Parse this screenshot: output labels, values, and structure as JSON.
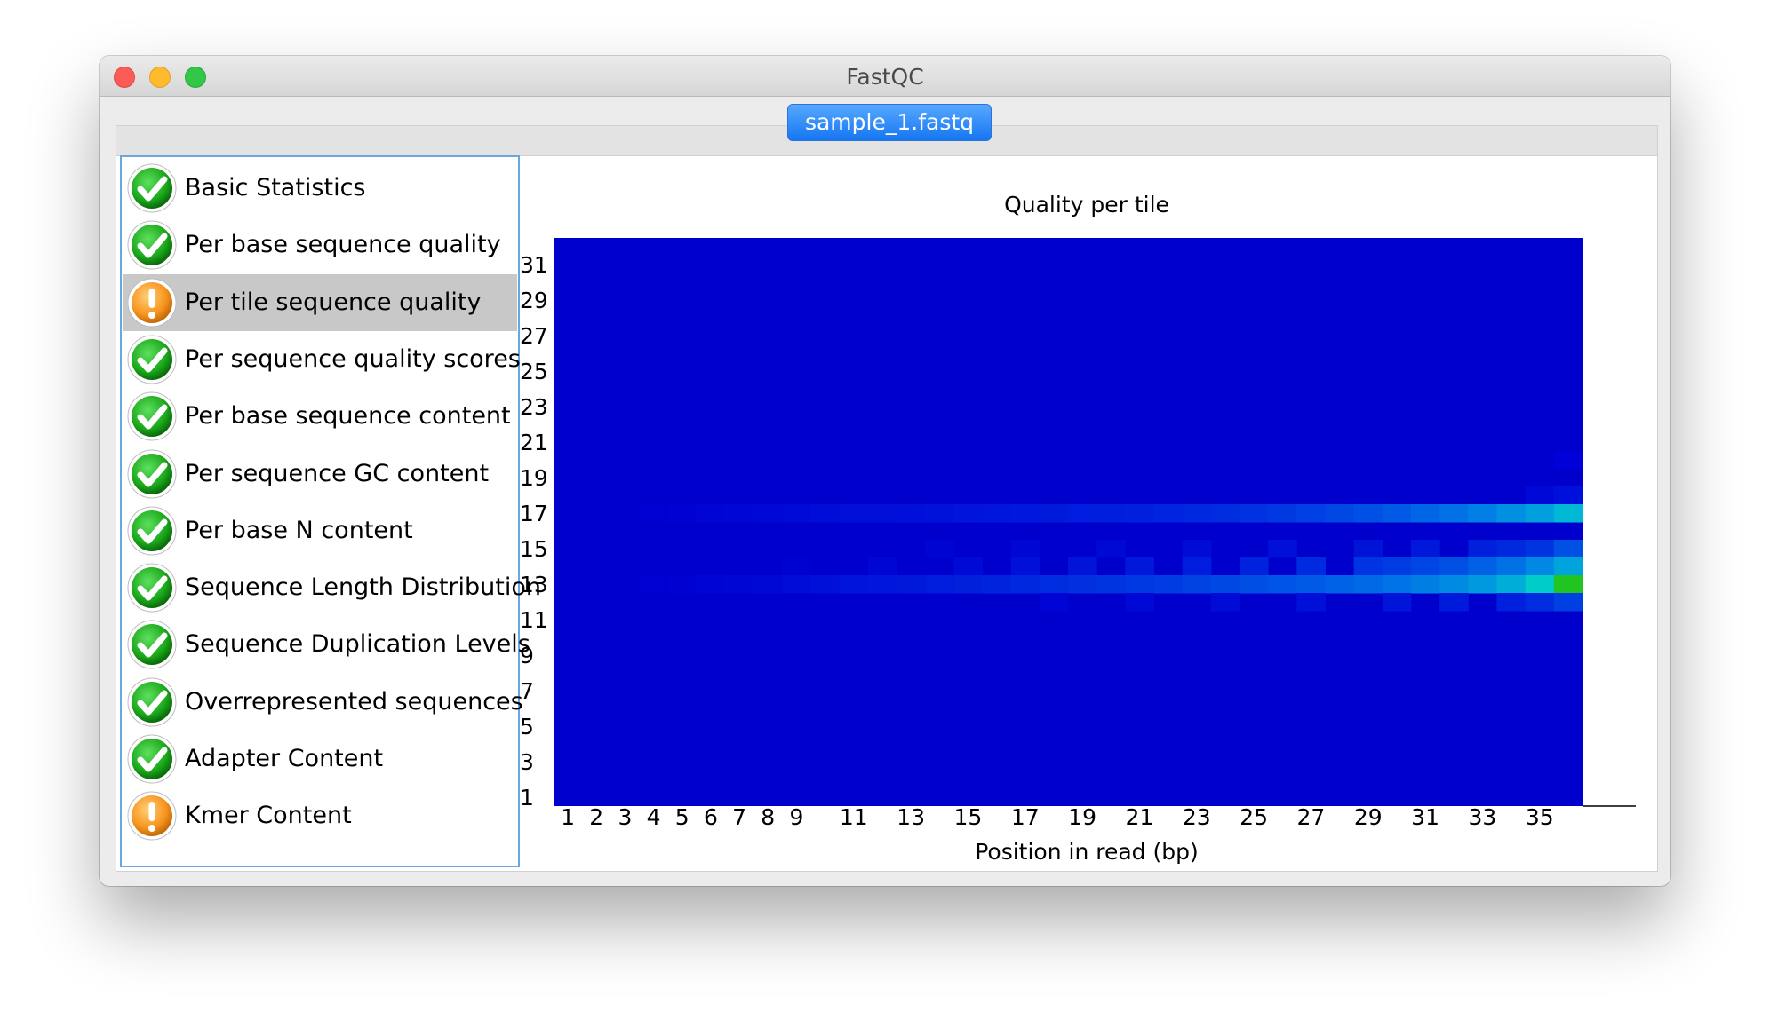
{
  "window": {
    "title": "FastQC"
  },
  "tab": {
    "label": "sample_1.fastq"
  },
  "modules": [
    {
      "label": "Basic Statistics",
      "status": "pass",
      "selected": false
    },
    {
      "label": "Per base sequence quality",
      "status": "pass",
      "selected": false
    },
    {
      "label": "Per tile sequence quality",
      "status": "warn",
      "selected": true
    },
    {
      "label": "Per sequence quality scores",
      "status": "pass",
      "selected": false
    },
    {
      "label": "Per base sequence content",
      "status": "pass",
      "selected": false
    },
    {
      "label": "Per sequence GC content",
      "status": "pass",
      "selected": false
    },
    {
      "label": "Per base N content",
      "status": "pass",
      "selected": false
    },
    {
      "label": "Sequence Length Distribution",
      "status": "pass",
      "selected": false
    },
    {
      "label": "Sequence Duplication Levels",
      "status": "pass",
      "selected": false
    },
    {
      "label": "Overrepresented sequences",
      "status": "pass",
      "selected": false
    },
    {
      "label": "Adapter Content",
      "status": "pass",
      "selected": false
    },
    {
      "label": "Kmer Content",
      "status": "warn",
      "selected": false
    }
  ],
  "icons": {
    "pass": "check-circle-icon",
    "warn": "warning-circle-icon"
  },
  "colors": {
    "pass": "#1aa81a",
    "warn": "#f7931e",
    "heat_base": "#0000cc",
    "selection": "#c8c8c8",
    "accent": "#1676f2"
  },
  "chart_data": {
    "type": "heatmap",
    "title": "Quality per tile",
    "xlabel": "Position in read (bp)",
    "ylabel": "",
    "x_ticks": [
      "1",
      "2",
      "3",
      "4",
      "5",
      "6",
      "7",
      "8",
      "9",
      "11",
      "13",
      "15",
      "17",
      "19",
      "21",
      "23",
      "25",
      "27",
      "29",
      "31",
      "33",
      "35"
    ],
    "y_ticks": [
      "31",
      "29",
      "27",
      "25",
      "23",
      "21",
      "19",
      "17",
      "15",
      "13",
      "11",
      "9",
      "7",
      "5",
      "3",
      "1"
    ],
    "x_range": [
      1,
      36
    ],
    "y_range": [
      1,
      32
    ],
    "background_color": "#0000cc",
    "hot_rows": [
      {
        "tile": 20,
        "cells": [
          [
            36,
            "#0000d8"
          ]
        ]
      },
      {
        "tile": 18,
        "cells": [
          [
            35,
            "#0008d8"
          ],
          [
            36,
            "#0010dc"
          ]
        ]
      },
      {
        "tile": 17,
        "cells": [
          [
            4,
            "#0000d2"
          ],
          [
            5,
            "#0002d4"
          ],
          [
            6,
            "#0004d4"
          ],
          [
            7,
            "#0006d6"
          ],
          [
            8,
            "#0008d6"
          ],
          [
            9,
            "#000ad8"
          ],
          [
            10,
            "#000cd8"
          ],
          [
            11,
            "#000ed8"
          ],
          [
            12,
            "#000ed8"
          ],
          [
            13,
            "#0010da"
          ],
          [
            14,
            "#0012da"
          ],
          [
            15,
            "#0014da"
          ],
          [
            16,
            "#0016dc"
          ],
          [
            17,
            "#0018dc"
          ],
          [
            18,
            "#001adc"
          ],
          [
            19,
            "#001cde"
          ],
          [
            20,
            "#001ede"
          ],
          [
            21,
            "#0020de"
          ],
          [
            22,
            "#0024e0"
          ],
          [
            23,
            "#0028e0"
          ],
          [
            24,
            "#002ce0"
          ],
          [
            25,
            "#0032e2"
          ],
          [
            26,
            "#0038e2"
          ],
          [
            27,
            "#0040e4"
          ],
          [
            28,
            "#0048e4"
          ],
          [
            29,
            "#0050e6"
          ],
          [
            30,
            "#005ae6"
          ],
          [
            31,
            "#0066e6"
          ],
          [
            32,
            "#0072e6"
          ],
          [
            33,
            "#0080e6"
          ],
          [
            34,
            "#0090e2"
          ],
          [
            35,
            "#00a0de"
          ],
          [
            36,
            "#00b8d4"
          ]
        ]
      },
      {
        "tile": 15,
        "cells": [
          [
            14,
            "#0004d2"
          ],
          [
            17,
            "#0006d4"
          ],
          [
            20,
            "#0008d4"
          ],
          [
            23,
            "#000cd6"
          ],
          [
            26,
            "#0010d8"
          ],
          [
            29,
            "#0014d8"
          ],
          [
            31,
            "#0018da"
          ],
          [
            33,
            "#0020dc"
          ],
          [
            34,
            "#0028de"
          ],
          [
            35,
            "#0034e0"
          ],
          [
            36,
            "#0050e4"
          ]
        ]
      },
      {
        "tile": 14,
        "cells": [
          [
            9,
            "#0002d0"
          ],
          [
            12,
            "#0006d4"
          ],
          [
            15,
            "#000ad6"
          ],
          [
            17,
            "#0010d8"
          ],
          [
            19,
            "#0014da"
          ],
          [
            21,
            "#0018da"
          ],
          [
            23,
            "#001cdc"
          ],
          [
            25,
            "#0022de"
          ],
          [
            27,
            "#002ae0"
          ],
          [
            29,
            "#0034e2"
          ],
          [
            30,
            "#003ce2"
          ],
          [
            31,
            "#0046e4"
          ],
          [
            32,
            "#0050e4"
          ],
          [
            33,
            "#0060e6"
          ],
          [
            34,
            "#0072e6"
          ],
          [
            35,
            "#0088e4"
          ],
          [
            36,
            "#00a4dc"
          ]
        ]
      },
      {
        "tile": 13,
        "cells": [
          [
            4,
            "#0000d2"
          ],
          [
            5,
            "#0002d2"
          ],
          [
            6,
            "#0004d4"
          ],
          [
            7,
            "#0006d4"
          ],
          [
            8,
            "#0008d6"
          ],
          [
            9,
            "#000cd8"
          ],
          [
            10,
            "#0010d8"
          ],
          [
            11,
            "#0014da"
          ],
          [
            12,
            "#0016da"
          ],
          [
            13,
            "#0018da"
          ],
          [
            14,
            "#001cdc"
          ],
          [
            15,
            "#0020dc"
          ],
          [
            16,
            "#0024de"
          ],
          [
            17,
            "#0028de"
          ],
          [
            18,
            "#002ce0"
          ],
          [
            19,
            "#0030e0"
          ],
          [
            20,
            "#0034e0"
          ],
          [
            21,
            "#0038e2"
          ],
          [
            22,
            "#003ce2"
          ],
          [
            23,
            "#0042e2"
          ],
          [
            24,
            "#0048e4"
          ],
          [
            25,
            "#004ee4"
          ],
          [
            26,
            "#0054e6"
          ],
          [
            27,
            "#005ae6"
          ],
          [
            28,
            "#0062e6"
          ],
          [
            29,
            "#006ae6"
          ],
          [
            30,
            "#0074e6"
          ],
          [
            31,
            "#007ee4"
          ],
          [
            32,
            "#008ae2"
          ],
          [
            33,
            "#0098de"
          ],
          [
            34,
            "#00acd8"
          ],
          [
            35,
            "#00ccc8"
          ],
          [
            36,
            "#22c422"
          ]
        ]
      },
      {
        "tile": 12,
        "cells": [
          [
            18,
            "#0004d4"
          ],
          [
            21,
            "#0008d6"
          ],
          [
            24,
            "#000cd6"
          ],
          [
            27,
            "#0010d8"
          ],
          [
            30,
            "#0014da"
          ],
          [
            32,
            "#001adc"
          ],
          [
            34,
            "#0020de"
          ],
          [
            35,
            "#002ce0"
          ],
          [
            36,
            "#0040e2"
          ]
        ]
      }
    ]
  }
}
